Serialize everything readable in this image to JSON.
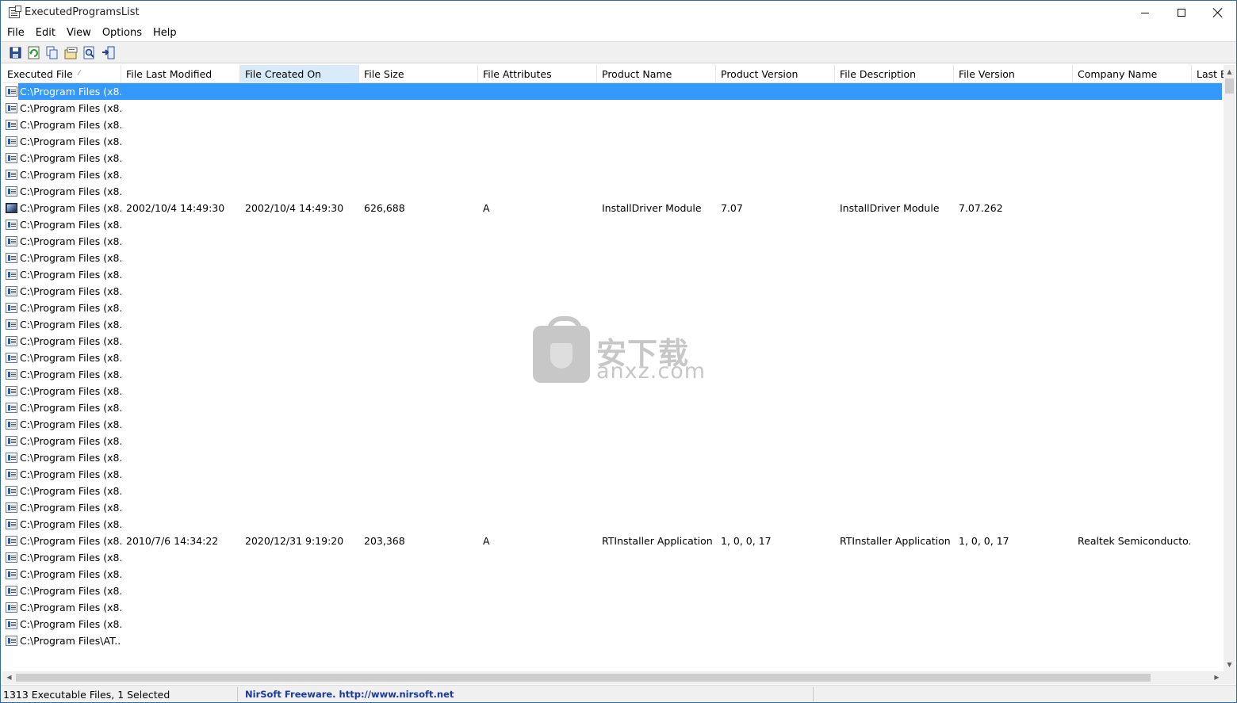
{
  "window": {
    "title": "ExecutedProgramsList"
  },
  "menu": [
    "File",
    "Edit",
    "View",
    "Options",
    "Help"
  ],
  "toolbar": [
    {
      "name": "save-icon"
    },
    {
      "name": "refresh-icon"
    },
    {
      "name": "copy-icon"
    },
    {
      "name": "properties-icon"
    },
    {
      "name": "find-icon"
    },
    {
      "name": "exit-icon"
    }
  ],
  "columns": [
    {
      "label": "Executed File",
      "sort": "ascending"
    },
    {
      "label": "File Last Modified"
    },
    {
      "label": "File Created On",
      "active": true
    },
    {
      "label": "File Size"
    },
    {
      "label": "File Attributes"
    },
    {
      "label": "Product Name"
    },
    {
      "label": "Product Version"
    },
    {
      "label": "File Description"
    },
    {
      "label": "File Version"
    },
    {
      "label": "Company Name"
    },
    {
      "label": "Last E"
    }
  ],
  "rows": [
    {
      "file": "C:\\Program Files (x8...",
      "selected": true
    },
    {
      "file": "C:\\Program Files (x8..."
    },
    {
      "file": "C:\\Program Files (x8..."
    },
    {
      "file": "C:\\Program Files (x8..."
    },
    {
      "file": "C:\\Program Files (x8..."
    },
    {
      "file": "C:\\Program Files (x8..."
    },
    {
      "file": "C:\\Program Files (x8..."
    },
    {
      "file": "C:\\Program Files (x8...",
      "icon": "image",
      "modified": "2002/10/4 14:49:30",
      "created": "2002/10/4 14:49:30",
      "size": "626,688",
      "attributes": "A",
      "product_name": "InstallDriver Module",
      "product_version": "7.07",
      "description": "InstallDriver Module",
      "file_version": "7.07.262",
      "company": ""
    },
    {
      "file": "C:\\Program Files (x8..."
    },
    {
      "file": "C:\\Program Files (x8..."
    },
    {
      "file": "C:\\Program Files (x8..."
    },
    {
      "file": "C:\\Program Files (x8..."
    },
    {
      "file": "C:\\Program Files (x8..."
    },
    {
      "file": "C:\\Program Files (x8..."
    },
    {
      "file": "C:\\Program Files (x8..."
    },
    {
      "file": "C:\\Program Files (x8..."
    },
    {
      "file": "C:\\Program Files (x8..."
    },
    {
      "file": "C:\\Program Files (x8..."
    },
    {
      "file": "C:\\Program Files (x8..."
    },
    {
      "file": "C:\\Program Files (x8..."
    },
    {
      "file": "C:\\Program Files (x8..."
    },
    {
      "file": "C:\\Program Files (x8..."
    },
    {
      "file": "C:\\Program Files (x8..."
    },
    {
      "file": "C:\\Program Files (x8..."
    },
    {
      "file": "C:\\Program Files (x8..."
    },
    {
      "file": "C:\\Program Files (x8..."
    },
    {
      "file": "C:\\Program Files (x8..."
    },
    {
      "file": "C:\\Program Files (x8...",
      "modified": "2010/7/6 14:34:22",
      "created": "2020/12/31 9:19:20",
      "size": "203,368",
      "attributes": "A",
      "product_name": "RTInstaller Application",
      "product_version": "1, 0, 0, 17",
      "description": "RTInstaller Application",
      "file_version": "1, 0, 0, 17",
      "company": "Realtek Semiconducto..."
    },
    {
      "file": "C:\\Program Files (x8..."
    },
    {
      "file": "C:\\Program Files (x8..."
    },
    {
      "file": "C:\\Program Files (x8..."
    },
    {
      "file": "C:\\Program Files (x8..."
    },
    {
      "file": "C:\\Program Files (x8..."
    },
    {
      "file": "C:\\Program Files\\AT..."
    }
  ],
  "status": {
    "count": "1313 Executable Files, 1 Selected",
    "freeware": "NirSoft Freeware.  http://www.nirsoft.net"
  },
  "watermark": {
    "cn": "安下载",
    "en": "anxz.com"
  }
}
